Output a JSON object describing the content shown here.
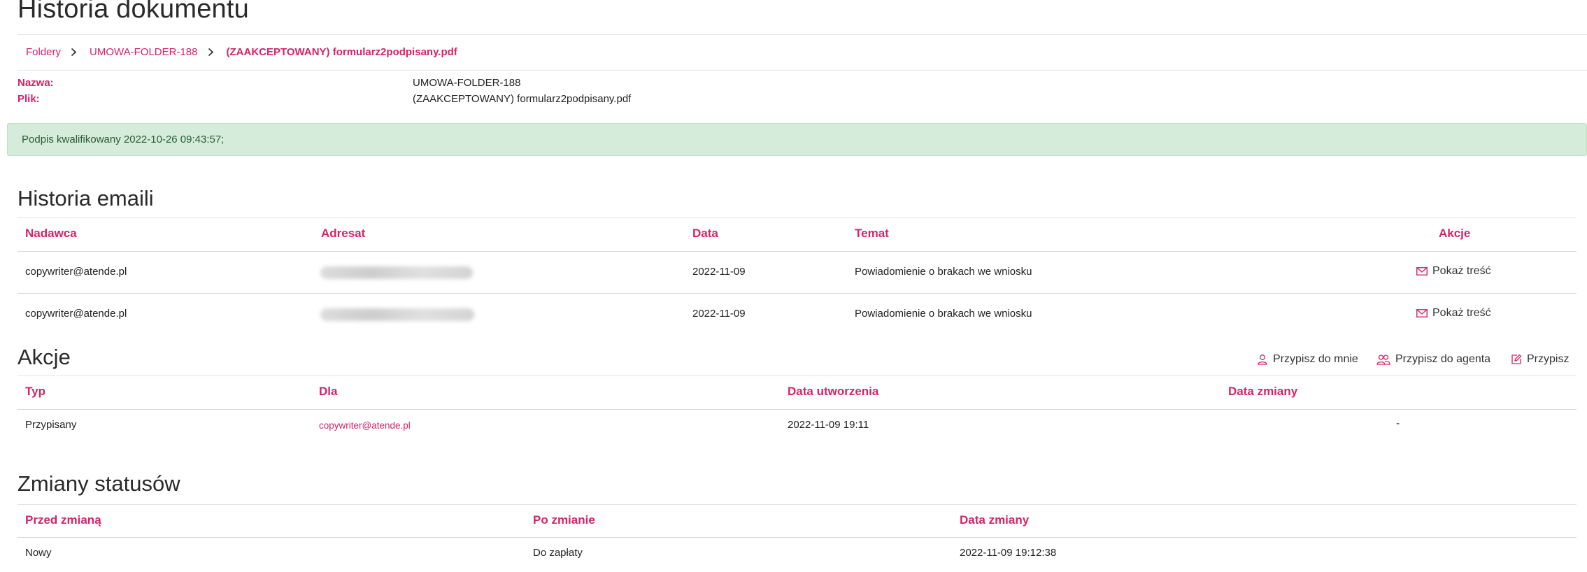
{
  "page": {
    "title": "Historia dokumentu"
  },
  "breadcrumb": [
    {
      "label": "Foldery"
    },
    {
      "label": "UMOWA-FOLDER-188"
    },
    {
      "label": "(ZAAKCEPTOWANY) formularz2podpisany.pdf"
    }
  ],
  "meta": {
    "name_label": "Nazwa:",
    "name_value": "UMOWA-FOLDER-188",
    "file_label": "Plik:",
    "file_value": "(ZAAKCEPTOWANY) formularz2podpisany.pdf"
  },
  "alert": {
    "text": "Podpis kwalifikowany 2022-10-26 09:43:57;"
  },
  "emails": {
    "title": "Historia emaili",
    "headers": {
      "sender": "Nadawca",
      "recipient": "Adresat",
      "date": "Data",
      "subject": "Temat",
      "actions": "Akcje"
    },
    "rows": [
      {
        "sender": "copywriter@atende.pl",
        "date": "2022-11-09",
        "subject": "Powiadomienie o brakach we wniosku",
        "action": "Pokaż treść",
        "action_icon": "envelope-icon"
      },
      {
        "sender": "copywriter@atende.pl",
        "date": "2022-11-09",
        "subject": "Powiadomienie o brakach we wniosku",
        "action": "Pokaż treść",
        "action_icon": "envelope-icon"
      }
    ]
  },
  "actions": {
    "title": "Akcje",
    "buttons": {
      "assign_me": "Przypisz do mnie",
      "assign_agent": "Przypisz do agenta",
      "assign": "Przypisz"
    },
    "headers": {
      "type": "Typ",
      "for": "Dla",
      "created": "Data utworzenia",
      "changed": "Data zmiany"
    },
    "rows": [
      {
        "type": "Przypisany",
        "for": "copywriter@atende.pl",
        "created": "2022-11-09 19:11",
        "changed": "-"
      }
    ]
  },
  "statuses": {
    "title": "Zmiany statusów",
    "headers": {
      "before": "Przed zmianą",
      "after": "Po zmianie",
      "date": "Data zmiany"
    },
    "rows": [
      {
        "before": "Nowy",
        "after": "Do zapłaty",
        "date": "2022-11-09 19:12:38"
      }
    ]
  },
  "colors": {
    "accent": "#d2246a",
    "alert_bg": "#d4ecd9",
    "alert_text": "#2c5a36"
  }
}
